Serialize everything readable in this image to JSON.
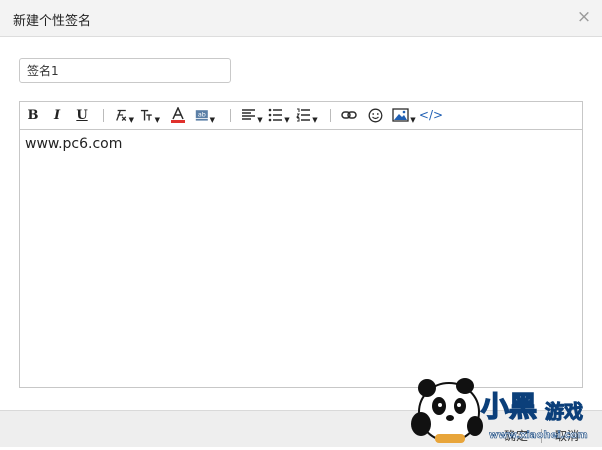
{
  "dialog": {
    "title": "新建个性签名",
    "close_glyph": "×"
  },
  "name_field": {
    "value": "签名1"
  },
  "toolbar": {
    "bold": "B",
    "italic": "I",
    "underline": "U",
    "items": [
      "bold",
      "italic",
      "underline",
      "font-family-icon",
      "font-size-icon",
      "font-color-icon",
      "background-color-icon",
      "align-icon",
      "unordered-list-icon",
      "ordered-list-icon",
      "link-icon",
      "emoji-icon",
      "image-icon",
      "code-icon"
    ],
    "code_label": "</>",
    "font_color_accent": "#e0312c",
    "icon_color": "#1f5fb3"
  },
  "editor": {
    "content": "www.pc6.com"
  },
  "footer": {
    "ok_label": "确定",
    "cancel_label": "取消"
  },
  "watermark": {
    "brand_text": "小黑游戏",
    "url_text": "www.xiaohei.com"
  }
}
